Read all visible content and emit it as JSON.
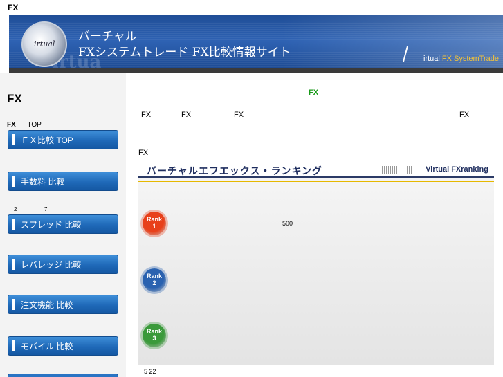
{
  "page": {
    "top_label": "FX"
  },
  "banner": {
    "title_line1": "バーチャル",
    "title_line2": "FXシステムトレード FX比較情報サイト",
    "logo_text": "irtual",
    "watermark": "irtua",
    "right_text_main": "irtual",
    "right_text_accent": "FX SystemTrade"
  },
  "sidebar": {
    "title": "FX",
    "crumb_bold": "FX",
    "crumb_text": "TOP",
    "note_left": "2",
    "note_right": "7",
    "buttons": [
      {
        "label": "ＦＸ比較 TOP"
      },
      {
        "label": "手数料 比較"
      },
      {
        "label": "スプレッド 比較"
      },
      {
        "label": "レバレッジ 比較"
      },
      {
        "label": "注文機能 比較"
      },
      {
        "label": "モバイル 比較"
      }
    ]
  },
  "main": {
    "green_fx": "FX",
    "fx_row": [
      "FX",
      "FX",
      "FX",
      "FX"
    ],
    "section_label": "FX",
    "footer_num": "5 22"
  },
  "ranking": {
    "title": "バーチャルエフエックス・ランキング",
    "title_en": "Virtual FXranking",
    "ranks": [
      {
        "label": "Rank",
        "num": "1",
        "color": "#e8401a"
      },
      {
        "label": "Rank",
        "num": "2",
        "color": "#2a62b0"
      },
      {
        "label": "Rank",
        "num": "3",
        "color": "#3a9a3a"
      }
    ],
    "rank1_value": "500"
  }
}
